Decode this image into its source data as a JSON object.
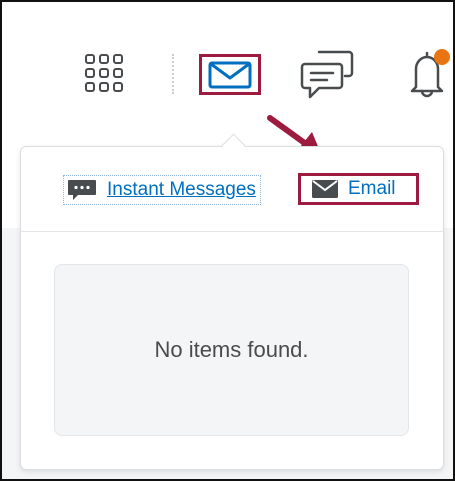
{
  "navbar": {
    "icons": {
      "waffle": "waffle-grid-icon",
      "email": "envelope-icon",
      "messages": "chat-bubbles-icon",
      "notifications": "bell-icon"
    },
    "notification_dot_color": "#e87511",
    "active_color": "#006fbf"
  },
  "dropdown": {
    "tabs": [
      {
        "label": "Instant Messages",
        "icon": "speech-bubble-icon"
      },
      {
        "label": "Email",
        "icon": "envelope-icon"
      }
    ],
    "empty_message": "No items found."
  },
  "annotation": {
    "highlight_color": "#9c1b3f",
    "arrow_icon": "arrow-icon"
  }
}
